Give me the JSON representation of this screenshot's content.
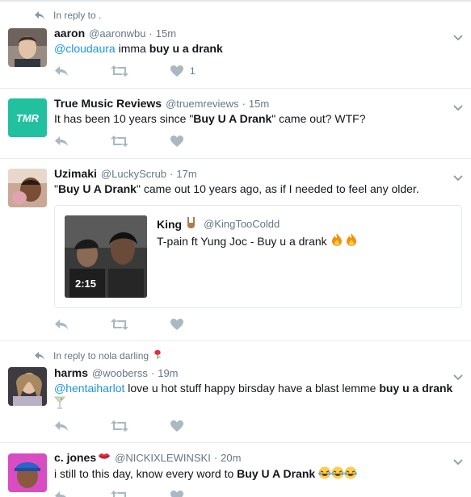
{
  "tweets": [
    {
      "reply_context": "In reply to .",
      "name": "aaron",
      "handle": "@aaronwbu",
      "time": "15m",
      "text_mention": "@cloudaura",
      "text_plain": " imma ",
      "text_bold": "buy u a drank",
      "like_count": "1"
    },
    {
      "avatar_text": "TMR",
      "name": "True Music Reviews",
      "handle": "@truemreviews",
      "time": "15m",
      "text_pre": "It has been 10 years since \"",
      "text_bold": "Buy U A Drank",
      "text_post": "\" came out? WTF?"
    },
    {
      "name": "Uzimaki",
      "handle": "@LuckyScrub",
      "time": "17m",
      "text_pre": "\"",
      "text_bold": "Buy U A Drank",
      "text_post": "\" came out 10 years ago, as if I needed to feel any older.",
      "quote": {
        "name": "King",
        "handle": "@KingTooColdd",
        "text": "T-pain ft Yung Joc - Buy u a drank",
        "duration": "2:15"
      }
    },
    {
      "reply_context": "In reply to nola darling",
      "name": "harms",
      "handle": "@wooberss",
      "time": "19m",
      "text_mention": "@hentaiharlot",
      "text_plain": " love u hot stuff happy birsday have a blast lemme ",
      "text_bold": "buy u a drank"
    },
    {
      "name": "c. jones",
      "handle": "@NICKIXLEWINSKI",
      "time": "20m",
      "text_pre": "i still to this day, know every word to ",
      "text_bold": "Buy U A Drank"
    }
  ],
  "colors": {
    "link": "#1b95e0",
    "muted": "#657786",
    "icon": "#aab8c2",
    "divider": "#e6ecf0",
    "tmr_avatar": "#21c1a0"
  },
  "icons": [
    "reply-icon",
    "retweet-icon",
    "like-icon",
    "chevron-down-icon",
    "reply-arrow-icon"
  ]
}
